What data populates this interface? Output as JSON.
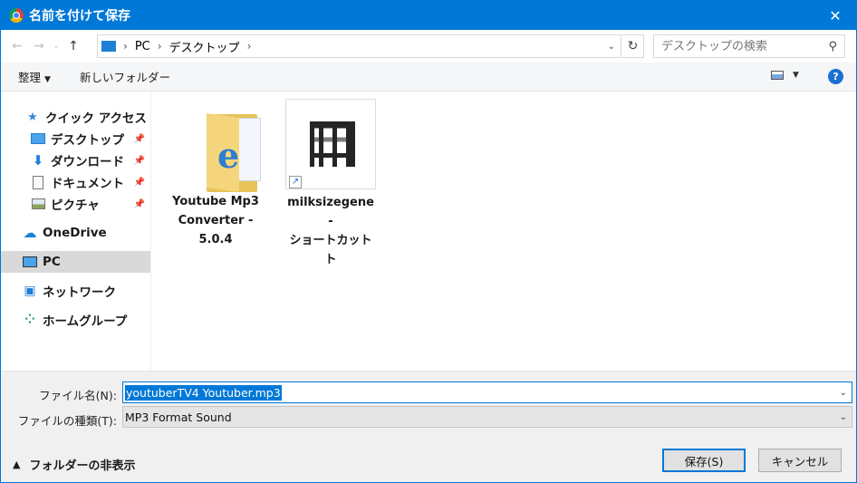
{
  "window": {
    "title": "名前を付けて保存",
    "close_glyph": "✕"
  },
  "address": {
    "crumbs": [
      "PC",
      "デスクトップ"
    ],
    "search_placeholder": "デスクトップの検索"
  },
  "toolbar": {
    "organize_label": "整理",
    "new_folder_label": "新しいフォルダー",
    "help_label": "?"
  },
  "sidebar": {
    "items": [
      {
        "label": "クイック アクセス",
        "icon": "star-icon"
      },
      {
        "label": "デスクトップ",
        "icon": "desktop-icon",
        "pinned": true
      },
      {
        "label": "ダウンロード",
        "icon": "download-arrow-icon",
        "pinned": true
      },
      {
        "label": "ドキュメント",
        "icon": "document-icon",
        "pinned": true
      },
      {
        "label": "ピクチャ",
        "icon": "picture-icon",
        "pinned": true
      },
      {
        "label": "OneDrive",
        "icon": "cloud-icon"
      },
      {
        "label": "PC",
        "icon": "computer-icon",
        "selected": true
      },
      {
        "label": "ネットワーク",
        "icon": "network-icon"
      },
      {
        "label": "ホームグループ",
        "icon": "homegroup-icon"
      }
    ]
  },
  "files": [
    {
      "label_lines": [
        "Youtube Mp3",
        "Converter -",
        "5.0.4"
      ],
      "icon": "folder-icon"
    },
    {
      "label_lines": [
        "milksizegene -",
        "ショートカット",
        "ト"
      ],
      "icon": "shortcut-icon"
    }
  ],
  "form": {
    "filename_label": "ファイル名(N):",
    "filename_value": "youtuberTV4  Youtuber.mp3",
    "filetype_label": "ファイルの種類(T):",
    "filetype_value": "MP3 Format Sound"
  },
  "footer": {
    "hide_folders_label": "フォルダーの非表示",
    "save_label": "保存(S)",
    "cancel_label": "キャンセル"
  },
  "colors": {
    "accent": "#0078d7",
    "selection": "#d9d9d9"
  }
}
